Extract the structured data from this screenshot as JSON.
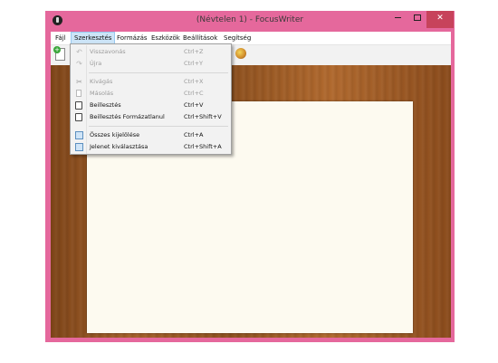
{
  "window": {
    "title": "(Névtelen 1) - FocusWriter",
    "minimize_glyph": "—",
    "maximize_glyph": "□",
    "close_glyph": "✕",
    "frame_color": "#e5689c",
    "close_color": "#c7435b"
  },
  "menubar": {
    "items": [
      {
        "label": "Fájl"
      },
      {
        "label": "Szerkesztés",
        "active": true
      },
      {
        "label": "Formázás"
      },
      {
        "label": "Eszközök"
      },
      {
        "label": "Beállítások"
      },
      {
        "label": "Segítség"
      }
    ]
  },
  "toolbar": {
    "icons": [
      "new-document-icon",
      "theme-icon"
    ]
  },
  "edit_menu": {
    "items": [
      {
        "label": "Visszavonás",
        "shortcut": "Ctrl+Z",
        "enabled": false,
        "icon": "undo-icon"
      },
      {
        "label": "Újra",
        "shortcut": "Ctrl+Y",
        "enabled": false,
        "icon": "redo-icon"
      },
      {
        "label": "Kivágás",
        "shortcut": "Ctrl+X",
        "enabled": false,
        "icon": "cut-icon"
      },
      {
        "label": "Másolás",
        "shortcut": "Ctrl+C",
        "enabled": false,
        "icon": "copy-icon"
      },
      {
        "label": "Beillesztés",
        "shortcut": "Ctrl+V",
        "enabled": true,
        "icon": "paste-icon"
      },
      {
        "label": "Beillesztés Formázatlanul",
        "shortcut": "Ctrl+Shift+V",
        "enabled": true,
        "icon": "paste-plain-icon"
      },
      {
        "label": "Összes kijelölése",
        "shortcut": "Ctrl+A",
        "enabled": true,
        "icon": "select-all-icon"
      },
      {
        "label": "Jelenet kiválasztása",
        "shortcut": "Ctrl+Shift+A",
        "enabled": true,
        "icon": "select-scene-icon"
      }
    ]
  },
  "colors": {
    "paper": "#fdfaf0",
    "wood": "#9a5522",
    "menu_highlight": "#cce4f7"
  }
}
